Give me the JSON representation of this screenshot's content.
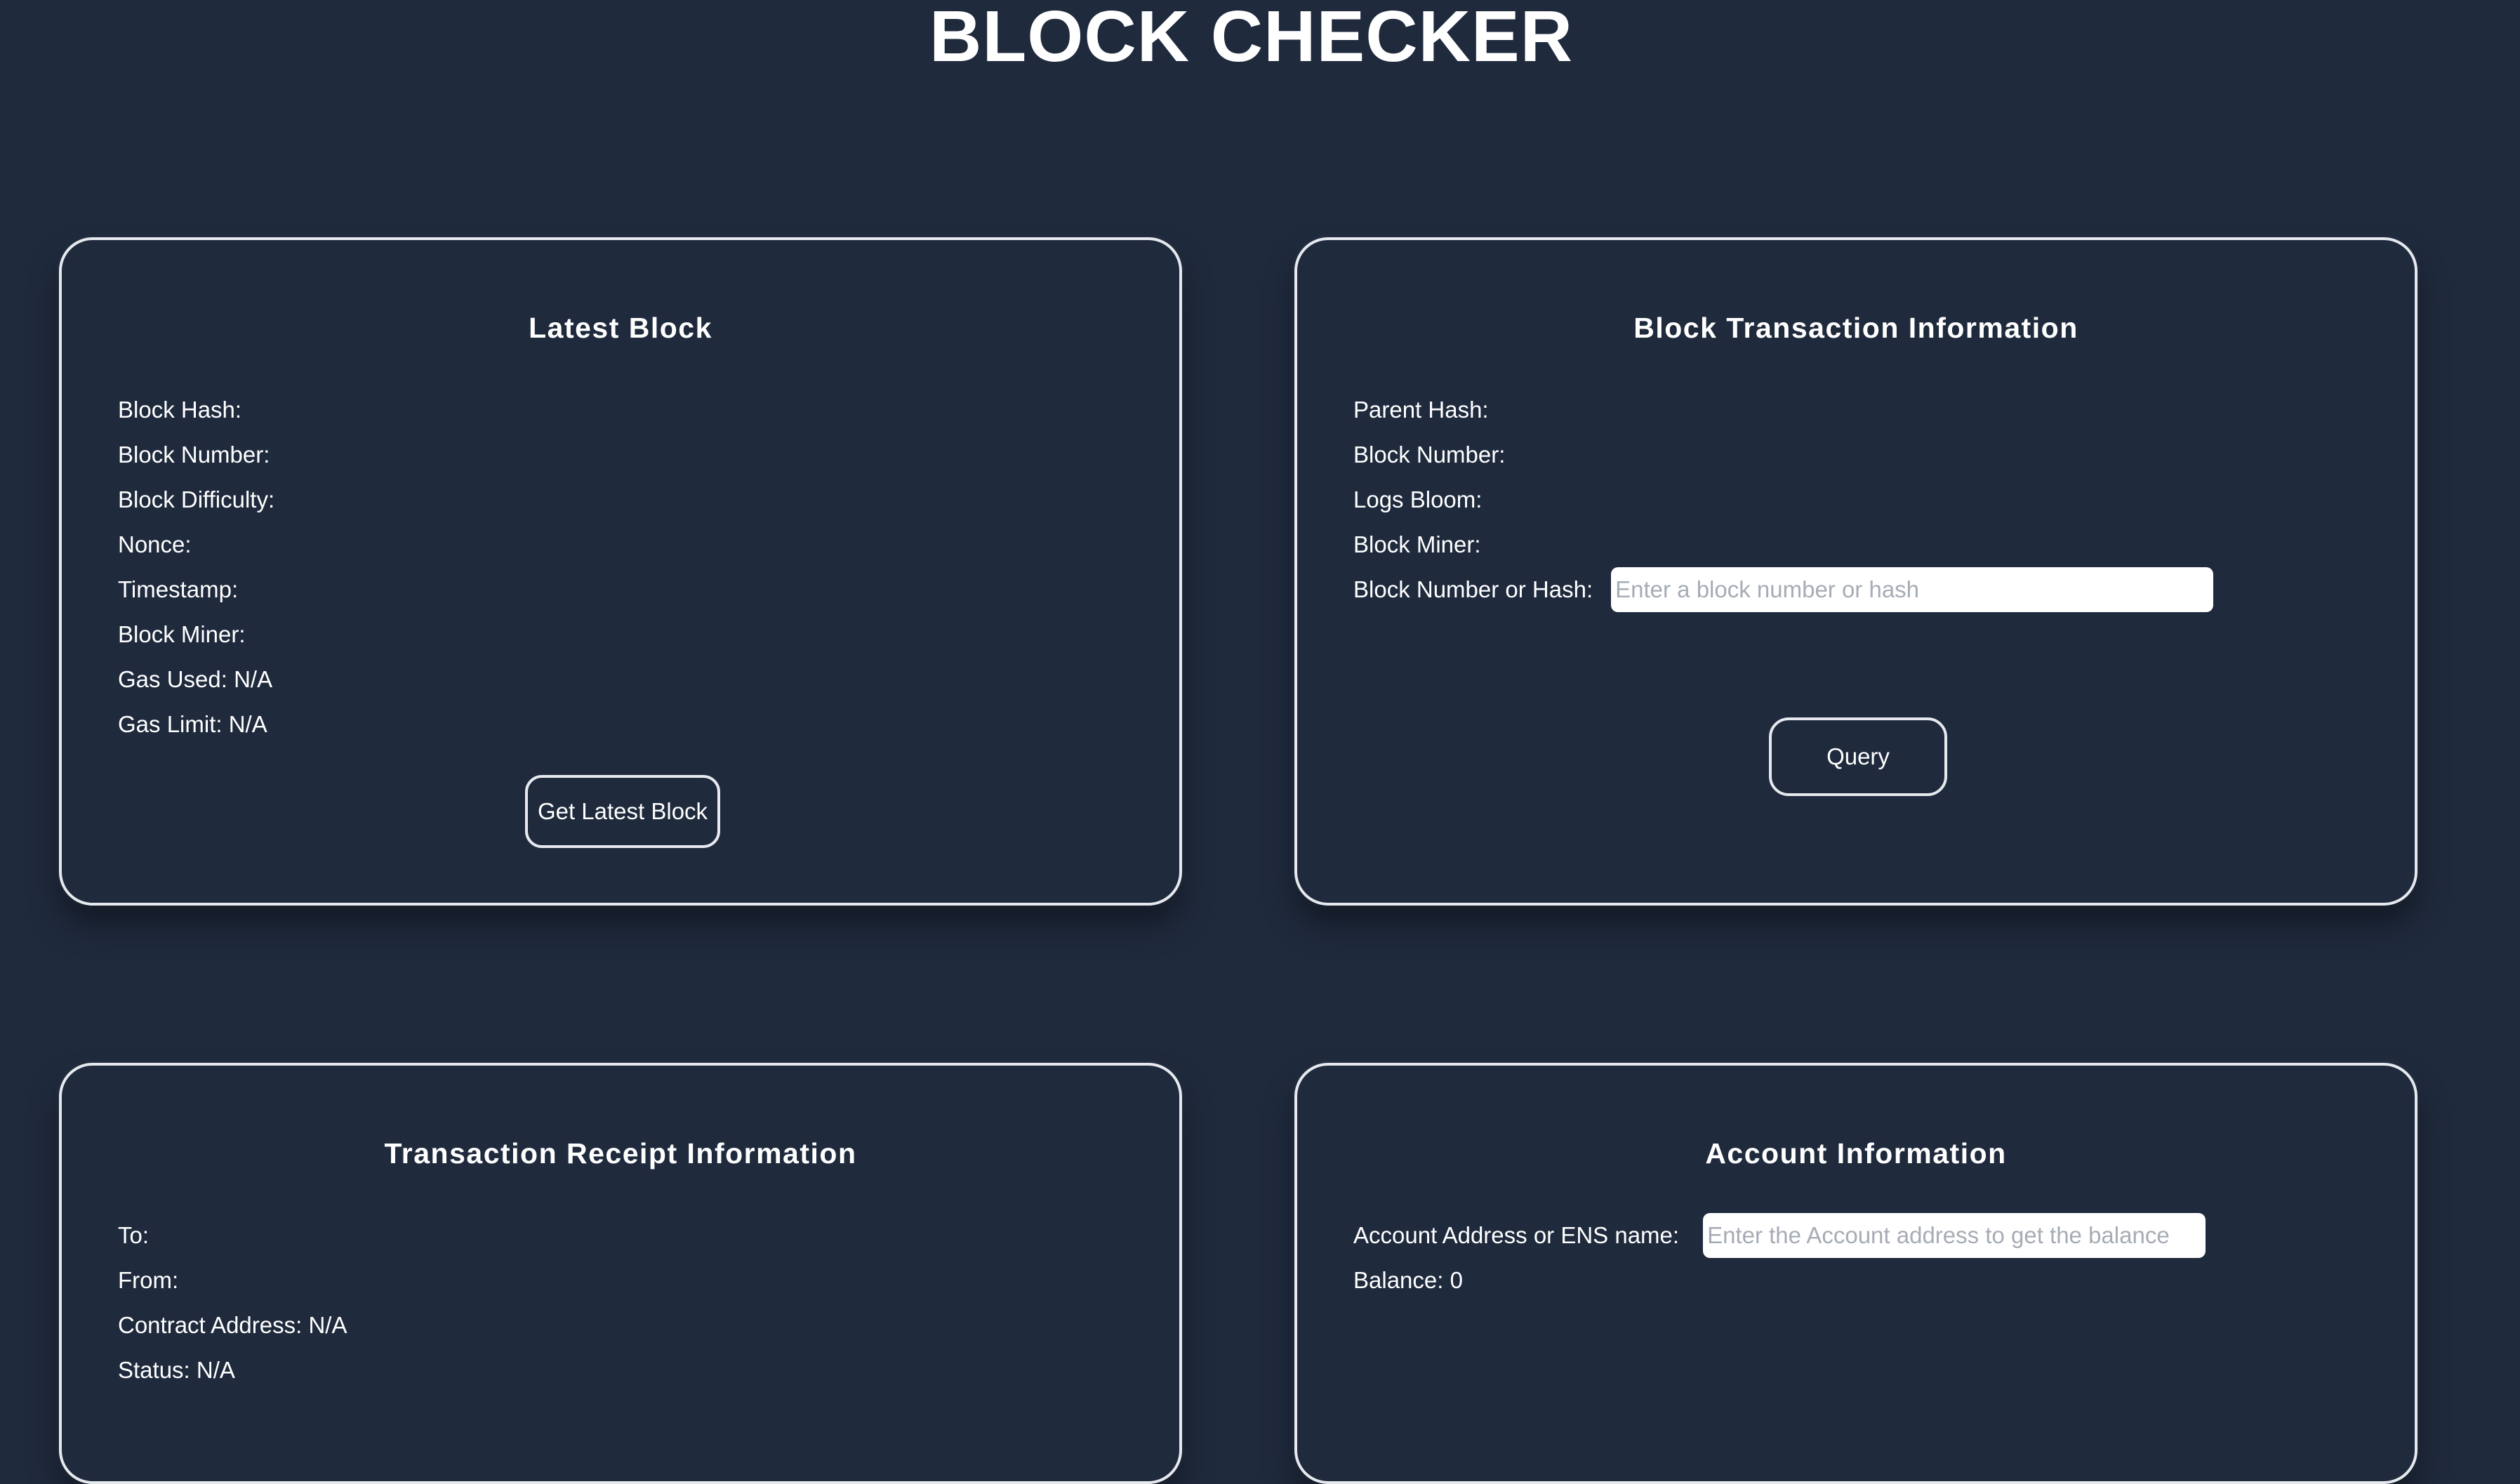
{
  "app": {
    "title": "BLOCK CHECKER"
  },
  "latest_block": {
    "title": "Latest Block",
    "fields": [
      "Block Hash:",
      "Block Number:",
      "Block Difficulty:",
      "Nonce:",
      "Timestamp:",
      "Block Miner:",
      "Gas Used: N/A",
      "Gas Limit: N/A"
    ],
    "button_label": "Get Latest Block"
  },
  "block_tx": {
    "title": "Block Transaction Information",
    "fields": [
      "Parent Hash:",
      "Block Number:",
      "Logs Bloom:",
      "Block Miner:"
    ],
    "input_label": "Block Number or Hash:",
    "input_placeholder": "Enter a block number or hash",
    "input_value": "",
    "button_label": "Query"
  },
  "receipt": {
    "title": "Transaction Receipt Information",
    "fields": [
      "To:",
      "From:",
      "Contract Address: N/A",
      "Status: N/A"
    ]
  },
  "account": {
    "title": "Account Information",
    "input_label": "Account Address or ENS name:",
    "input_placeholder": "Enter the Account address to get the balance",
    "input_value": "",
    "balance": "Balance: 0"
  }
}
